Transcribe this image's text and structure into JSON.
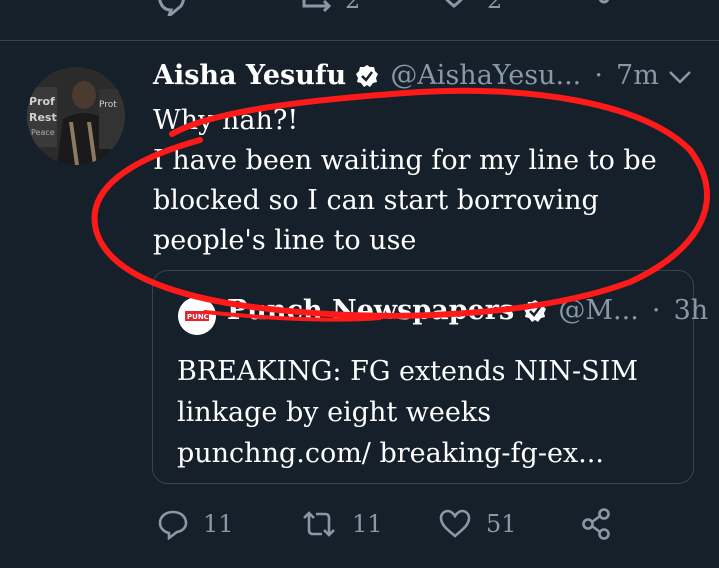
{
  "prev_tweet": {
    "retweets": "2",
    "likes": "2"
  },
  "tweet": {
    "author_name": "Aisha Yesufu",
    "handle": "@AishaYesu...",
    "separator": "·",
    "time": "7m",
    "text": "Why nah?!\nI have been waiting for my line to be blocked so I can start borrowing people's line to use",
    "replies": "11",
    "retweets": "11",
    "likes": "51"
  },
  "quoted": {
    "author_name": "Punch Newspapers",
    "handle": "@M...",
    "separator": "·",
    "time": "3h",
    "text": "BREAKING: FG extends NIN-SIM linkage by eight weeks\npunchng.com/ breaking-fg-ex..."
  },
  "colors": {
    "background": "#15202b",
    "muted": "#8899a6",
    "divider": "#38444d",
    "annotation": "#ff1a1a"
  },
  "icons": [
    "reply-icon",
    "retweet-icon",
    "like-icon",
    "share-icon",
    "verified-icon",
    "chevron-down-icon"
  ]
}
